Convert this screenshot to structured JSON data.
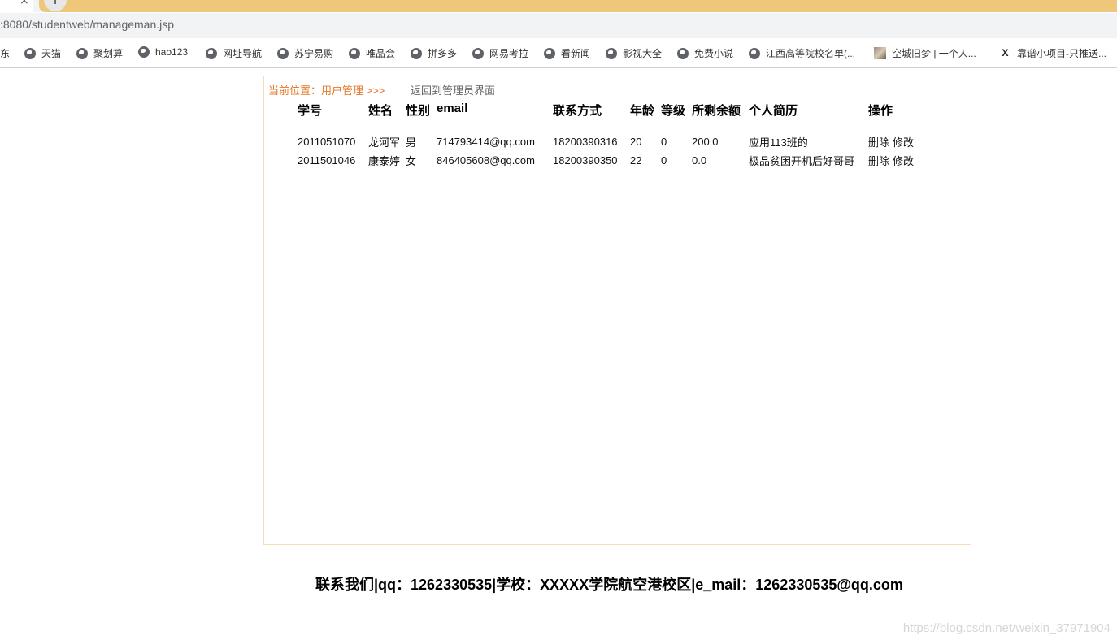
{
  "browser": {
    "tab_close": "×",
    "new_tab": "+",
    "url": ":8080/studentweb/manageman.jsp",
    "bookmarks": [
      {
        "label": "东",
        "icon": "none"
      },
      {
        "label": "天猫",
        "icon": "globe-icon"
      },
      {
        "label": "聚划算",
        "icon": "globe-icon"
      },
      {
        "label": "hao123",
        "icon": "globe-icon"
      },
      {
        "label": "网址导航",
        "icon": "globe-icon"
      },
      {
        "label": "苏宁易购",
        "icon": "globe-icon"
      },
      {
        "label": "唯品会",
        "icon": "globe-icon"
      },
      {
        "label": "拼多多",
        "icon": "globe-icon"
      },
      {
        "label": "网易考拉",
        "icon": "globe-icon"
      },
      {
        "label": "看新闻",
        "icon": "globe-icon"
      },
      {
        "label": "影视大全",
        "icon": "globe-icon"
      },
      {
        "label": "免费小说",
        "icon": "globe-icon"
      },
      {
        "label": "江西高等院校名单(...",
        "icon": "globe-icon"
      },
      {
        "label": "空城旧梦 | 一个人...",
        "icon": "image-favicon"
      },
      {
        "label": "靠谱小项目-只推送...",
        "icon": "x-favicon"
      }
    ]
  },
  "page": {
    "breadcrumb": "当前位置：用户管理 >>>",
    "back_link": "返回到管理员界面",
    "table": {
      "headers": [
        "学号",
        "姓名",
        "性别",
        "email",
        "联系方式",
        "年龄",
        "等级",
        "所剩余额",
        "个人简历",
        "操作"
      ],
      "rows": [
        {
          "id": "2011051070",
          "name": "龙河军",
          "gender": "男",
          "email": "714793414@qq.com",
          "phone": "18200390316",
          "age": "20",
          "level": "0",
          "balance": "200.0",
          "resume": "应用113班的",
          "delete": "删除",
          "edit": "修改"
        },
        {
          "id": "2011501046",
          "name": "康泰婷",
          "gender": "女",
          "email": "846405608@qq.com",
          "phone": "18200390350",
          "age": "22",
          "level": "0",
          "balance": "0.0",
          "resume": "极品贫困开机后好哥哥",
          "delete": "删除",
          "edit": "修改"
        }
      ]
    }
  },
  "footer": {
    "text": "联系我们|qq：1262330535|学校：XXXXX学院航空港校区|e_mail：1262330535@qq.com"
  },
  "watermark": "https://blog.csdn.net/weixin_37971904",
  "colors": {
    "accent": "#e4792a",
    "panel_border": "#f3dfb3",
    "tab_orange": "#efc77a"
  }
}
